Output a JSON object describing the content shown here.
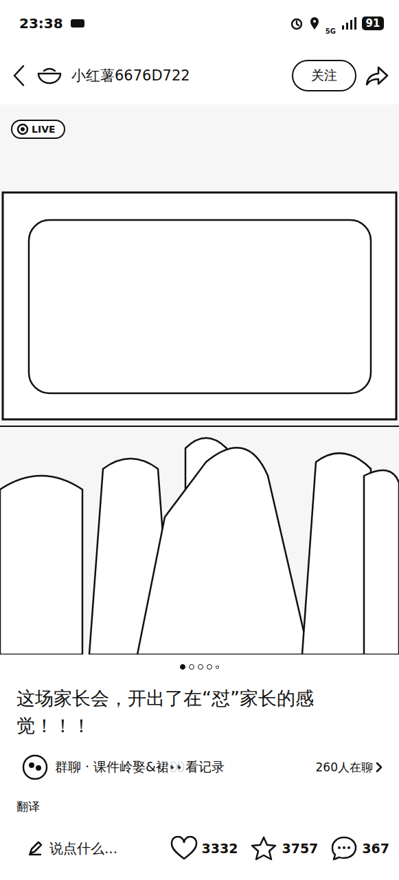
{
  "status_bar": {
    "time": "23:38",
    "network": "5G",
    "battery": "91"
  },
  "header": {
    "author": "小红薯6676D722",
    "follow_button": "关注"
  },
  "media": {
    "badge": "LIVE"
  },
  "pagination": [
    {
      "selected": true
    },
    {
      "selected": false
    },
    {
      "selected": false
    },
    {
      "selected": false
    },
    {
      "selected": false
    }
  ],
  "post": {
    "title": "这场家长会，开出了在“怼”家长的感觉！！！"
  },
  "group_chat": {
    "label": "群聊 · 课件岭娶&裙👀看记录",
    "online": "260人在聊"
  },
  "translate": "翻译",
  "bottom_bar": {
    "comment_placeholder": "说点什么...",
    "likes": "3332",
    "favorites": "3757",
    "comments": "367"
  }
}
